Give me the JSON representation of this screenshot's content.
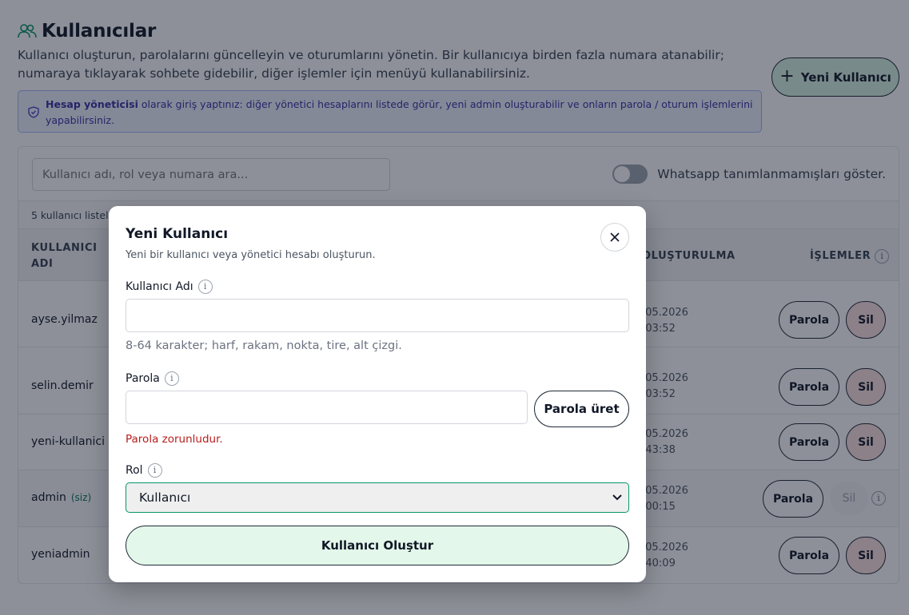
{
  "page": {
    "title": "Kullanıcılar",
    "description": "Kullanıcı oluşturun, parolalarını güncelleyin ve oturumlarını yönetin. Bir kullanıcıya birden fazla numara atanabilir; numaraya tıklayarak sohbete gidebilir, diğer işlemler için menüyü kullanabilirsiniz.",
    "new_user_label": "Yeni Kullanıcı"
  },
  "notice": {
    "bold": "Hesap yöneticisi",
    "text": " olarak giriş yaptınız: diğer yönetici hesaplarını listede görür, yeni admin oluşturabilir ve onların parola / oturum işlemlerini yapabilirsiniz."
  },
  "toolbar": {
    "search_placeholder": "Kullanıcı adı, rol veya numara ara...",
    "toggle_label": "Whatsapp tanımlanmamışları göster."
  },
  "table": {
    "count_text": "5 kullanıcı listel",
    "headers": {
      "username_line1": "KULLANICI",
      "username_line2": "ADI",
      "created": "OLUŞTURULMA",
      "actions": "İŞLEMLER"
    },
    "password_label": "Parola",
    "delete_label": "Sil",
    "you_label": "(siz)",
    "rows": [
      {
        "username": "ayse.yilmaz",
        "date": ".05.2026",
        "time": ":03:52"
      },
      {
        "username": "selin.demir",
        "date": ".05.2026",
        "time": ":03:52"
      },
      {
        "username": "yeni-kullanici",
        "date": ".05.2026",
        "time": ":43:38"
      },
      {
        "username": "admin",
        "date": ".05.2026",
        "time": ":00:15"
      },
      {
        "username": "yeniadmin",
        "date": ".05.2026",
        "time": ":40:09"
      }
    ]
  },
  "modal": {
    "title": "Yeni Kullanıcı",
    "subtitle": "Yeni bir kullanıcı veya yönetici hesabı oluşturun.",
    "username_label": "Kullanıcı Adı",
    "username_value": "",
    "username_hint": "8-64 karakter; harf, rakam, nokta, tire, alt çizgi.",
    "password_label": "Parola",
    "password_value": "",
    "generate_label": "Parola üret",
    "password_error": "Parola zorunludur.",
    "role_label": "Rol",
    "role_selected": "Kullanıcı",
    "submit_label": "Kullanıcı Oluştur"
  },
  "icons": {
    "info": "i",
    "close": "close-icon",
    "users": "users-icon",
    "shield": "shield-icon"
  },
  "colors": {
    "accent": "#059669",
    "notice_bg": "#eef2ff",
    "error": "#b91c1c",
    "primary_btn_bg": "#d8f3e4"
  }
}
